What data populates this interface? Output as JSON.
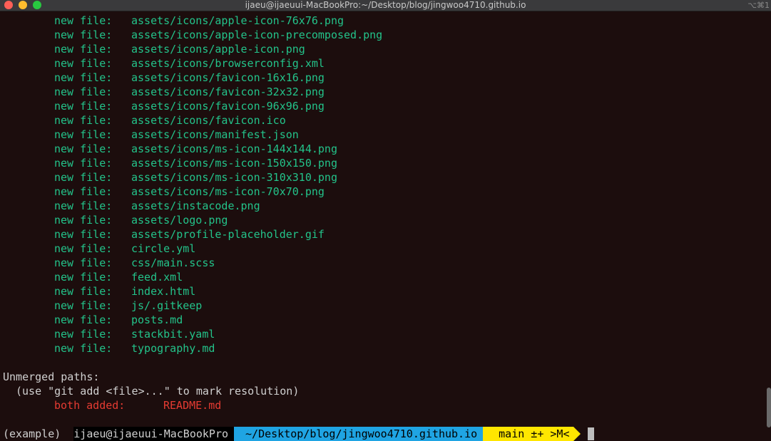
{
  "window": {
    "title": "ijaeu@ijaeuui-MacBookPro:~/Desktop/blog/jingwoo4710.github.io",
    "shortcut": "⌥⌘1"
  },
  "new_files": [
    {
      "status": "new file:",
      "path": "assets/icons/apple-icon-76x76.png"
    },
    {
      "status": "new file:",
      "path": "assets/icons/apple-icon-precomposed.png"
    },
    {
      "status": "new file:",
      "path": "assets/icons/apple-icon.png"
    },
    {
      "status": "new file:",
      "path": "assets/icons/browserconfig.xml"
    },
    {
      "status": "new file:",
      "path": "assets/icons/favicon-16x16.png"
    },
    {
      "status": "new file:",
      "path": "assets/icons/favicon-32x32.png"
    },
    {
      "status": "new file:",
      "path": "assets/icons/favicon-96x96.png"
    },
    {
      "status": "new file:",
      "path": "assets/icons/favicon.ico"
    },
    {
      "status": "new file:",
      "path": "assets/icons/manifest.json"
    },
    {
      "status": "new file:",
      "path": "assets/icons/ms-icon-144x144.png"
    },
    {
      "status": "new file:",
      "path": "assets/icons/ms-icon-150x150.png"
    },
    {
      "status": "new file:",
      "path": "assets/icons/ms-icon-310x310.png"
    },
    {
      "status": "new file:",
      "path": "assets/icons/ms-icon-70x70.png"
    },
    {
      "status": "new file:",
      "path": "assets/instacode.png"
    },
    {
      "status": "new file:",
      "path": "assets/logo.png"
    },
    {
      "status": "new file:",
      "path": "assets/profile-placeholder.gif"
    },
    {
      "status": "new file:",
      "path": "circle.yml"
    },
    {
      "status": "new file:",
      "path": "css/main.scss"
    },
    {
      "status": "new file:",
      "path": "feed.xml"
    },
    {
      "status": "new file:",
      "path": "index.html"
    },
    {
      "status": "new file:",
      "path": "js/.gitkeep"
    },
    {
      "status": "new file:",
      "path": "posts.md"
    },
    {
      "status": "new file:",
      "path": "stackbit.yaml"
    },
    {
      "status": "new file:",
      "path": "typography.md"
    }
  ],
  "unmerged": {
    "heading": "Unmerged paths:",
    "hint": "(use \"git add <file>...\" to mark resolution)",
    "status": "both added:",
    "path": "README.md"
  },
  "prompt": {
    "env": "(example)",
    "user_host": "ijaeu@ijaeuui-MacBookPro",
    "dir": "~/Desktop/blog/jingwoo4710.github.io",
    "branch_icon": "",
    "git": "main ±+ >M<"
  },
  "colors": {
    "added": "#23c38a",
    "conflict": "#e63b32",
    "dir_segment": "#1fa4e3",
    "git_segment": "#ffe600"
  }
}
